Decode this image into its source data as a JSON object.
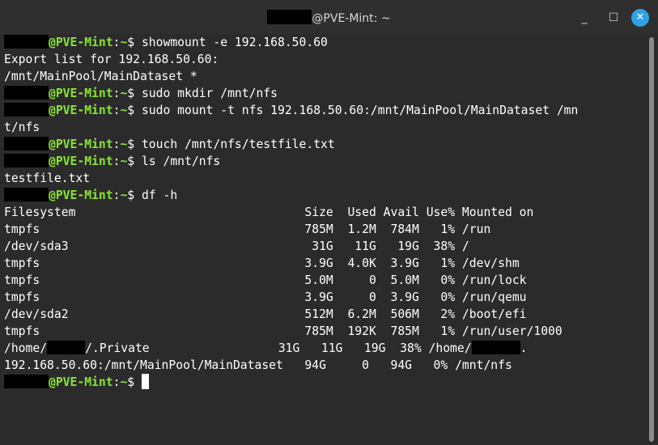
{
  "window": {
    "title": "@PVE-Mint: ~",
    "buttons": {
      "minimize": "_",
      "maximize": "☐",
      "close": "✕"
    }
  },
  "prompt": {
    "host": "@PVE-Mint",
    "colon": ":",
    "path": "~",
    "symbol": "$ "
  },
  "commands": {
    "c1": "showmount -e 192.168.50.60",
    "c2": "sudo mkdir /mnt/nfs",
    "c3": "sudo mount -t nfs 192.168.50.60:/mnt/MainPool/MainDataset /mn",
    "c4": "touch /mnt/nfs/testfile.txt",
    "c5": "ls /mnt/nfs",
    "c6": "df -h"
  },
  "output": {
    "export_list": "Export list for 192.168.50.60:",
    "export_entry": "/mnt/MainPool/MainDataset *",
    "wrap": "t/nfs",
    "ls_result": "testfile.txt"
  },
  "df": {
    "header": "Filesystem                                Size  Used Avail Use% Mounted on",
    "rows": [
      "tmpfs                                     785M  1.2M  784M   1% /run",
      "/dev/sda3                                  31G   11G   19G  38% /",
      "tmpfs                                     3.9G  4.0K  3.9G   1% /dev/shm",
      "tmpfs                                     5.0M     0  5.0M   0% /run/lock",
      "tmpfs                                     3.9G     0  3.9G   0% /run/qemu",
      "/dev/sda2                                 512M  6.2M  506M   2% /boot/efi",
      "tmpfs                                     785M  192K  785M   1% /run/user/1000"
    ],
    "private_row": {
      "pre": "/home/",
      "mid": "/.Private                  31G   11G   19G  38% /home/",
      "post": "."
    },
    "nfs_row": "192.168.50.60:/mnt/MainPool/MainDataset   94G     0   94G   0% /mnt/nfs"
  },
  "colors": {
    "host": "#8ae234",
    "close_button": "#2fa3e3",
    "background": "#2b2b2b"
  }
}
